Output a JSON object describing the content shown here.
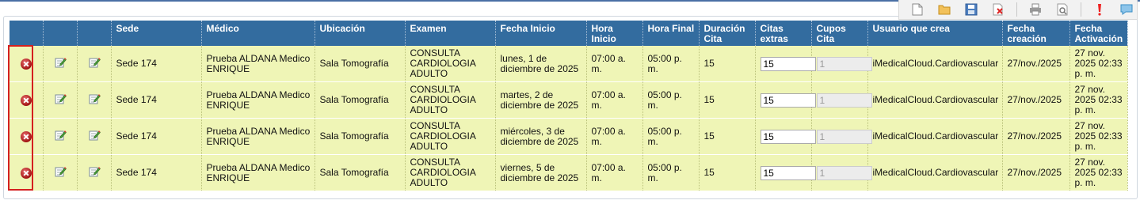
{
  "toolbar": {
    "buttons": [
      {
        "icon": "new-document-icon"
      },
      {
        "icon": "open-folder-icon"
      },
      {
        "icon": "save-icon"
      },
      {
        "icon": "delete-document-icon"
      },
      {
        "icon": "print-icon"
      },
      {
        "icon": "print-preview-icon"
      },
      {
        "icon": "alert-icon"
      },
      {
        "icon": "comment-icon"
      }
    ]
  },
  "table": {
    "headers": [
      "",
      "",
      "",
      "Sede",
      "Médico",
      "Ubicación",
      "Examen",
      "Fecha Inicio",
      "Hora Inicio",
      "Hora Final",
      "Duración Cita",
      "Citas extras",
      "Cupos Cita",
      "Usuario que crea",
      "Fecha creación",
      "Fecha Activación"
    ],
    "rows": [
      {
        "sede": "Sede 174",
        "medico": "Prueba ALDANA Medico ENRIQUE",
        "ubicacion": "Sala Tomografía",
        "examen": "CONSULTA CARDIOLOGIA ADULTO",
        "fecha_inicio": "lunes, 1 de diciembre de 2025",
        "hora_inicio": "07:00 a. m.",
        "hora_final": "05:00 p. m.",
        "duracion": "15",
        "citas_extras": "15",
        "cupos": "1",
        "usuario": "iMedicalCloud.Cardiovascular",
        "fecha_creacion": "27/nov./2025",
        "fecha_activacion": "27 nov. 2025 02:33 p. m."
      },
      {
        "sede": "Sede 174",
        "medico": "Prueba ALDANA Medico ENRIQUE",
        "ubicacion": "Sala Tomografía",
        "examen": "CONSULTA CARDIOLOGIA ADULTO",
        "fecha_inicio": "martes, 2 de diciembre de 2025",
        "hora_inicio": "07:00 a. m.",
        "hora_final": "05:00 p. m.",
        "duracion": "15",
        "citas_extras": "15",
        "cupos": "1",
        "usuario": "iMedicalCloud.Cardiovascular",
        "fecha_creacion": "27/nov./2025",
        "fecha_activacion": "27 nov. 2025 02:33 p. m."
      },
      {
        "sede": "Sede 174",
        "medico": "Prueba ALDANA Medico ENRIQUE",
        "ubicacion": "Sala Tomografía",
        "examen": "CONSULTA CARDIOLOGIA ADULTO",
        "fecha_inicio": "miércoles, 3 de diciembre de 2025",
        "hora_inicio": "07:00 a. m.",
        "hora_final": "05:00 p. m.",
        "duracion": "15",
        "citas_extras": "15",
        "cupos": "1",
        "usuario": "iMedicalCloud.Cardiovascular",
        "fecha_creacion": "27/nov./2025",
        "fecha_activacion": "27 nov. 2025 02:33 p. m."
      },
      {
        "sede": "Sede 174",
        "medico": "Prueba ALDANA Medico ENRIQUE",
        "ubicacion": "Sala Tomografía",
        "examen": "CONSULTA CARDIOLOGIA ADULTO",
        "fecha_inicio": "viernes, 5 de diciembre de 2025",
        "hora_inicio": "07:00 a. m.",
        "hora_final": "05:00 p. m.",
        "duracion": "15",
        "citas_extras": "15",
        "cupos": "1",
        "usuario": "iMedicalCloud.Cardiovascular",
        "fecha_creacion": "27/nov./2025",
        "fecha_activacion": "27 nov. 2025 02:33 p. m."
      }
    ]
  },
  "colors": {
    "header_bg": "#336c9f",
    "row_bg": "#eff5b6",
    "highlight": "#d42020"
  }
}
